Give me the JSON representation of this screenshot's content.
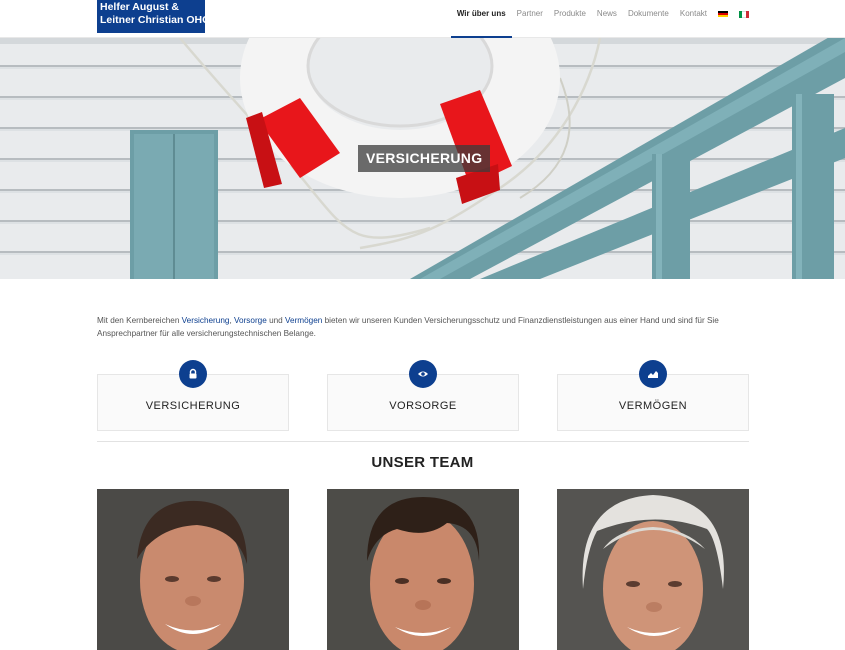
{
  "header": {
    "logo_line1": "Helfer August &",
    "logo_line2": "Leitner Christian OHG",
    "nav": [
      {
        "label": "Wir über uns",
        "active": true
      },
      {
        "label": "Partner"
      },
      {
        "label": "Produkte"
      },
      {
        "label": "News"
      },
      {
        "label": "Dokumente"
      },
      {
        "label": "Kontakt"
      }
    ],
    "flags": [
      "german-flag-icon",
      "italian-flag-icon"
    ]
  },
  "hero": {
    "title": "VERSICHERUNG"
  },
  "intro": {
    "text_before": "Mit den Kernbereichen ",
    "link1": "Versicherung",
    "sep1": ", ",
    "link2": "Vorsorge",
    "sep2": " und ",
    "link3": "Vermögen",
    "text_after": " bieten wir unseren Kunden Versicherungsschutz und Finanzdienstleistungen aus einer Hand und sind für Sie Ansprechpartner für alle versicherungstechnischen Belange."
  },
  "cards": [
    {
      "label": "VERSICHERUNG",
      "icon": "lock-icon"
    },
    {
      "label": "VORSORGE",
      "icon": "eye-icon"
    },
    {
      "label": "VERMÖGEN",
      "icon": "chart-icon"
    }
  ],
  "team": {
    "title": "UNSER TEAM"
  },
  "colors": {
    "brand": "#0d3f8f",
    "hero_overlay": "#3c3c3c",
    "railing": "#6fa0a8",
    "lifebuoy_red": "#e8161b"
  }
}
